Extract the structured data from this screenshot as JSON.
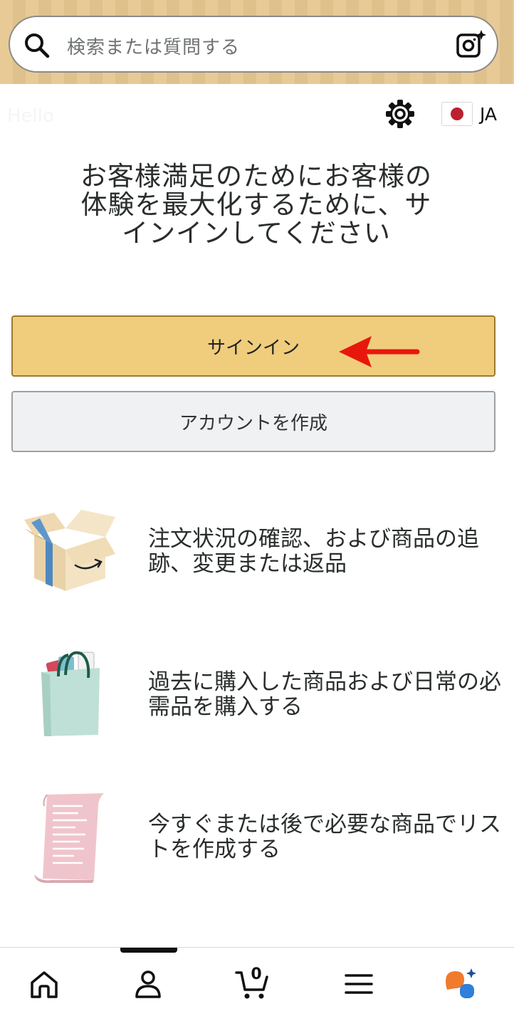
{
  "header": {
    "search_placeholder": "検索または質問する"
  },
  "greeting": "Hello",
  "language": {
    "code": "JA"
  },
  "headline": "お客様満足のためにお客様の体験を最大化するために、サインインしてください",
  "buttons": {
    "signin": "サインイン",
    "create_account": "アカウントを作成"
  },
  "features": [
    {
      "text": "注文状況の確認、および商品の追跡、変更または返品",
      "icon": "package-box-icon"
    },
    {
      "text": "過去に購入した商品および日常の必需品を購入する",
      "icon": "shopping-bag-icon"
    },
    {
      "text": "今すぐまたは後で必要な商品でリストを作成する",
      "icon": "list-scroll-icon"
    }
  ],
  "bottom_nav": {
    "cart_count": "0",
    "items": [
      "home-icon",
      "account-icon",
      "cart-icon",
      "menu-icon",
      "rufus-icon"
    ]
  },
  "colors": {
    "header_bg": "#e6c78f",
    "signin_bg": "#f0cd7c",
    "create_bg": "#eff1f3",
    "arrow": "#e8170c"
  }
}
